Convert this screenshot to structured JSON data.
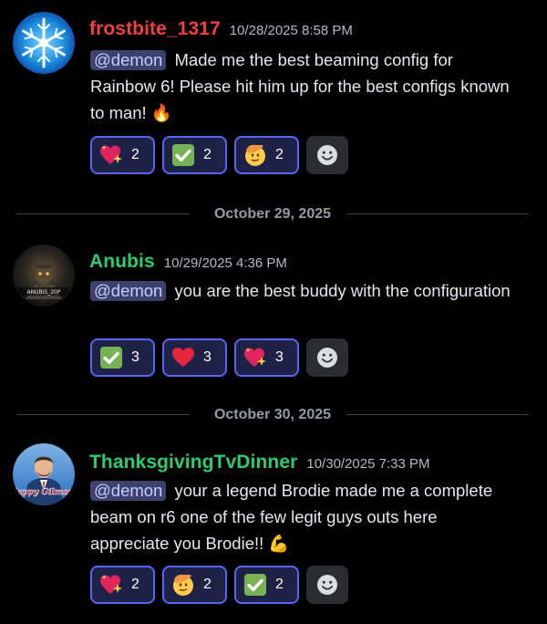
{
  "messages": [
    {
      "username": "frostbite_1317",
      "username_color": "#f23f43",
      "timestamp": "10/28/2025 8:58 PM",
      "mention": "@demon",
      "text": "Made me the best beaming config for Rainbow 6! Please hit him up for the best configs known to man! 🔥",
      "avatar": "snowflake-avatar",
      "reactions": [
        {
          "emoji": "sparkling-heart-icon",
          "count": "2"
        },
        {
          "emoji": "check-mark-icon",
          "count": "2"
        },
        {
          "emoji": "saluting-face-icon",
          "count": "2"
        }
      ]
    },
    {
      "username": "Anubis",
      "username_color": "#2ecc71",
      "timestamp": "10/29/2025 4:36 PM",
      "mention": "@demon",
      "text": "you are the best buddy with the configuration",
      "avatar": "anubis-avatar",
      "avatar_text": "ANUBIS_20P",
      "reactions": [
        {
          "emoji": "check-mark-icon",
          "count": "3"
        },
        {
          "emoji": "red-heart-icon",
          "count": "3"
        },
        {
          "emoji": "sparkling-heart-icon",
          "count": "3"
        }
      ]
    },
    {
      "username": "ThanksgivingTvDinner",
      "username_color": "#2ecc71",
      "timestamp": "10/30/2025 7:33 PM",
      "mention": "@demon",
      "text": "your a legend Brodie made me a complete beam on r6 one of the few legit guys outs here appreciate you Brodie!! 💪",
      "avatar": "happy-gilmore-avatar",
      "avatar_text": "Happy Gilmore",
      "reactions": [
        {
          "emoji": "sparkling-heart-icon",
          "count": "2"
        },
        {
          "emoji": "saluting-face-icon",
          "count": "2"
        },
        {
          "emoji": "check-mark-icon",
          "count": "2"
        }
      ]
    }
  ],
  "dividers": [
    "October 29, 2025",
    "October 30, 2025"
  ],
  "add_reaction_icon": "smiley-icon"
}
